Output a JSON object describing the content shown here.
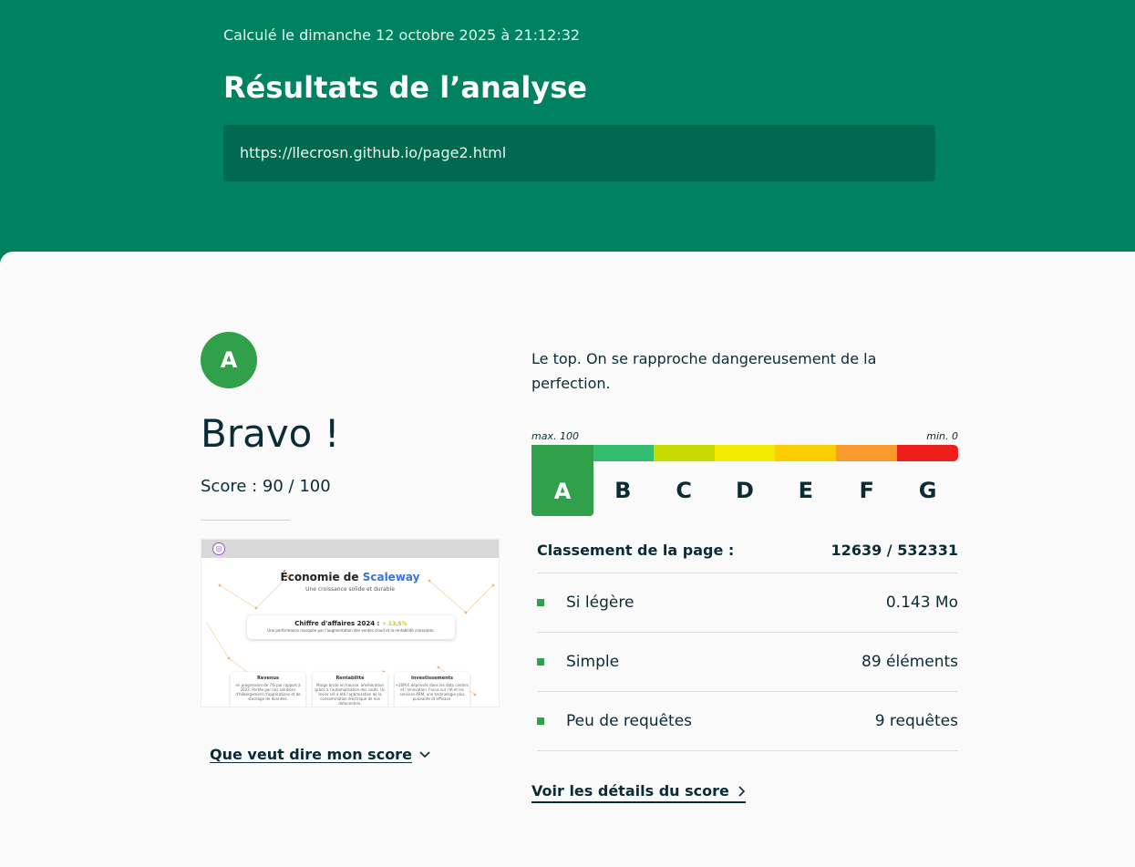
{
  "header": {
    "date": "Calculé le dimanche 12 octobre 2025 à 21:12:32",
    "title": "Résultats de l’analyse",
    "url": "https://llecrosn.github.io/page2.html"
  },
  "result": {
    "grade": "A",
    "headline": "Bravo !",
    "score_text": "Score : 90 / 100",
    "description": "Le top. On se rapproche dangereusement de la perfection.",
    "what_link": "Que veut dire mon score",
    "details_link": "Voir les détails du score"
  },
  "scale": {
    "max_label": "max. 100",
    "min_label": "min. 0",
    "active": "A",
    "grades": [
      {
        "letter": "A",
        "color": "#31a04a"
      },
      {
        "letter": "B",
        "color": "#34bd70"
      },
      {
        "letter": "C",
        "color": "#c6dc00"
      },
      {
        "letter": "D",
        "color": "#f3ea00"
      },
      {
        "letter": "E",
        "color": "#fbcc00"
      },
      {
        "letter": "F",
        "color": "#f89a2c"
      },
      {
        "letter": "G",
        "color": "#ec1f1c"
      }
    ]
  },
  "ranking": {
    "label": "Classement de la page :",
    "value": "12639 / 532331"
  },
  "metrics": [
    {
      "label": "Si légère",
      "value": "0.143 Mo"
    },
    {
      "label": "Simple",
      "value": "89 éléments"
    },
    {
      "label": "Peu de requêtes",
      "value": "9 requêtes"
    }
  ],
  "thumbnail": {
    "title_prefix": "Économie de ",
    "title_brand": "Scaleway",
    "subtitle": "Une croissance solide et durable",
    "card_title": "Chiffre d'affaires 2024 : ",
    "card_value": "+ 13,5%",
    "card_sub": "Une performance marquée par l'augmentation des ventes cloud et la rentabilité croissante.",
    "cards": [
      {
        "title": "Revenus",
        "text": "en progression de 7% par rapport à 2023. Portée par nos solutions d'hébergement d'applications et de stockage de données."
      },
      {
        "title": "Rentabilité",
        "text": "Marge brute en hausse. amélioration grâce à l'automatisation des coûts. Un levier clé a été l'optimisation de la consommation électrique de nos datacenters."
      },
      {
        "title": "Investissements",
        "text": "+20M € dépensés dans les data centers et l'innovation. Focus sur l'IA et les services ARM, une technologie plus puissante et efficace."
      }
    ]
  },
  "colors": {
    "primary": "#00815f",
    "grade_a": "#31a04a"
  }
}
